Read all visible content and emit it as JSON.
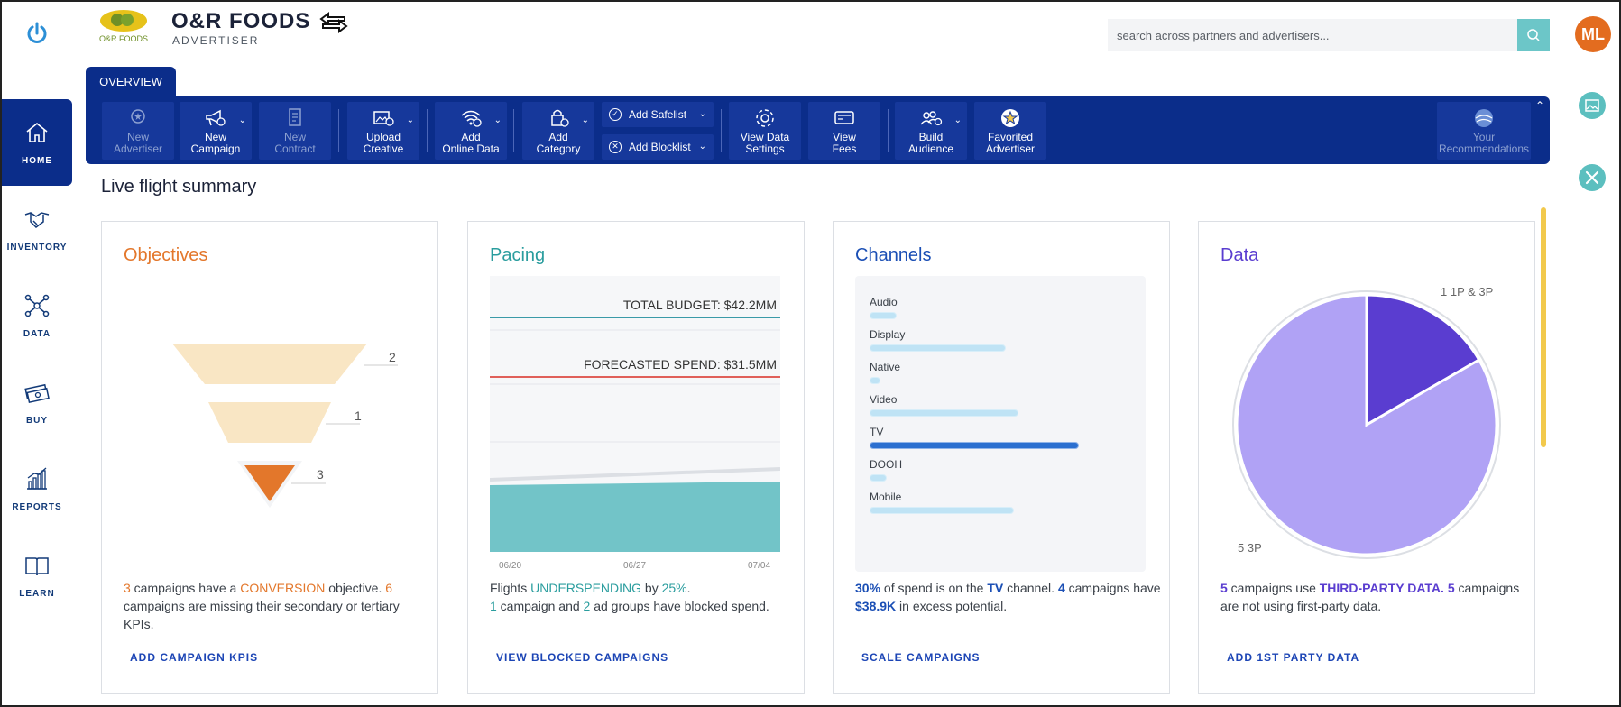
{
  "header": {
    "brand": "O&R FOODS",
    "brand_sub": "ADVERTISER",
    "logo_text": "O&R FOODS",
    "search_placeholder": "search across partners and advertisers...",
    "avatar": "ML"
  },
  "nav": [
    {
      "label": "HOME",
      "icon": "home-icon",
      "active": true
    },
    {
      "label": "INVENTORY",
      "icon": "handshake-icon"
    },
    {
      "label": "DATA",
      "icon": "network-icon"
    },
    {
      "label": "BUY",
      "icon": "money-icon"
    },
    {
      "label": "REPORTS",
      "icon": "bar-chart-icon"
    },
    {
      "label": "LEARN",
      "icon": "book-icon"
    }
  ],
  "tab": "OVERVIEW",
  "toolbar": {
    "new_advertiser": [
      "New",
      "Advertiser"
    ],
    "new_campaign": [
      "New",
      "Campaign"
    ],
    "new_contract": [
      "New",
      "Contract"
    ],
    "upload_creative": [
      "Upload",
      "Creative"
    ],
    "add_online_data": [
      "Add",
      "Online Data"
    ],
    "add_category": [
      "Add",
      "Category"
    ],
    "add_safelist": "Add Safelist",
    "add_blocklist": "Add Blocklist",
    "view_data_settings": [
      "View Data",
      "Settings"
    ],
    "view_fees": [
      "View",
      "Fees"
    ],
    "build_audience": [
      "Build",
      "Audience"
    ],
    "favorited_advertiser": [
      "Favorited",
      "Advertiser"
    ],
    "your_recommendations": [
      "Your",
      "Recommendations"
    ]
  },
  "section_title": "Live flight summary",
  "objectives": {
    "title": "Objectives",
    "funnel_levels": [
      2,
      1,
      3
    ],
    "desc": {
      "n1": "3",
      "t1": " campaigns have a ",
      "hl": "CONVERSION",
      "t2": " objective. ",
      "n2": "6",
      "t3": " campaigns are missing their secondary or tertiary KPIs."
    },
    "action": "ADD CAMPAIGN KPIS"
  },
  "pacing": {
    "title": "Pacing",
    "total_budget": "TOTAL BUDGET: $42.2MM",
    "forecasted": "FORECASTED SPEND: $31.5MM",
    "x_ticks": [
      "06/20",
      "06/27",
      "07/04"
    ],
    "desc": {
      "t1": "Flights ",
      "hl": "UNDERSPENDING",
      "t2": " by ",
      "pct": "25%",
      "t3": ".",
      "n1": "1",
      "t4": " campaign and ",
      "n2": "2",
      "t5": " ad groups have blocked spend."
    },
    "action": "VIEW BLOCKED CAMPAIGNS"
  },
  "channels": {
    "title": "Channels",
    "rows": [
      {
        "label": "Audio",
        "value": 0.13
      },
      {
        "label": "Display",
        "value": 0.65
      },
      {
        "label": "Native",
        "value": 0.05
      },
      {
        "label": "Video",
        "value": 0.71
      },
      {
        "label": "TV",
        "value": 1.0,
        "highlight": true
      },
      {
        "label": "DOOH",
        "value": 0.08
      },
      {
        "label": "Mobile",
        "value": 0.69
      }
    ],
    "desc": {
      "pct": "30%",
      "t1": " of spend is on the ",
      "hl": "TV",
      "t2": " channel. ",
      "n1": "4",
      "t3": " campaigns have ",
      "amt": "$38.9K",
      "t4": " in excess potential."
    },
    "action": "SCALE CAMPAIGNS"
  },
  "data_card": {
    "title": "Data",
    "slice1_label": "1 1P & 3P",
    "slice2_label": "5 3P",
    "desc": {
      "n1": "5",
      "t1": " campaigns use ",
      "hl": "THIRD-PARTY DATA.",
      "n2": " 5",
      "t2": " campaigns are not using first-party data."
    },
    "action": "ADD 1ST PARTY DATA"
  },
  "chart_data": {
    "type": "pie",
    "title": "Data",
    "slices": [
      {
        "label": "1P & 3P",
        "value": 1,
        "color": "#5a3dd0"
      },
      {
        "label": "3P",
        "value": 5,
        "color": "#b0a2f5"
      }
    ]
  },
  "colors": {
    "nav": "#0b2d8a",
    "accent_orange": "#e3772b",
    "accent_teal": "#2a9d9e"
  }
}
